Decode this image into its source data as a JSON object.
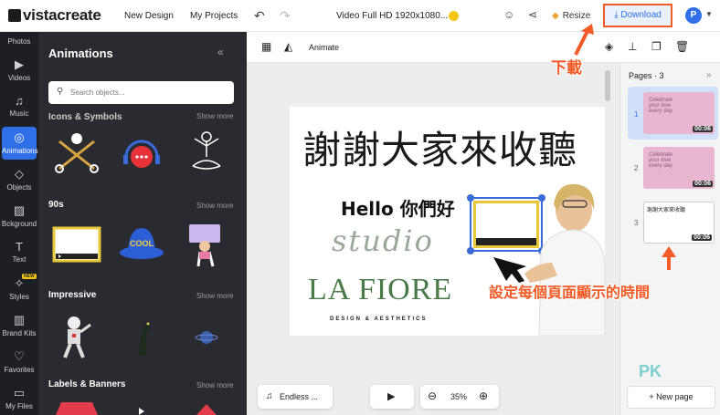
{
  "app": {
    "logo": "vistacreate",
    "nav": [
      "New Design",
      "My Projects"
    ],
    "doc_title": "Video Full HD 1920x1080...",
    "resize_label": "Resize",
    "download_label": "Download",
    "avatar_initial": "P"
  },
  "rail": [
    {
      "label": "Photos",
      "icon": "photos-icon"
    },
    {
      "label": "Videos",
      "icon": "videos-icon"
    },
    {
      "label": "Music",
      "icon": "music-icon"
    },
    {
      "label": "Animations",
      "icon": "animations-icon",
      "active": true
    },
    {
      "label": "Objects",
      "icon": "objects-icon"
    },
    {
      "label": "Bckground",
      "icon": "background-icon"
    },
    {
      "label": "Text",
      "icon": "text-icon"
    },
    {
      "label": "Styles",
      "icon": "styles-icon",
      "tag": "NEW"
    },
    {
      "label": "Brand Kits",
      "icon": "brand-kits-icon"
    },
    {
      "label": "Favorites",
      "icon": "favorites-icon"
    },
    {
      "label": "My Files",
      "icon": "my-files-icon"
    }
  ],
  "panel": {
    "title": "Animations",
    "search_placeholder": "Search objects...",
    "sections": [
      {
        "title": "Icons & Symbols",
        "show_more": "Show more"
      },
      {
        "title": "90s",
        "show_more": "Show more"
      },
      {
        "title": "Impressive",
        "show_more": "Show more"
      },
      {
        "title": "Labels & Banners",
        "show_more": "Show more"
      }
    ]
  },
  "toolbar": {
    "animate_label": "Animate"
  },
  "slide": {
    "headline": "謝謝大家來收聽",
    "hello_text": "Hello 你們好",
    "studio_text": "studio",
    "brand_name": "LA FIORE",
    "brand_tagline": "DESIGN & AESTHETICS"
  },
  "bottom": {
    "music_label": "Endless ...",
    "zoom": "35%"
  },
  "pages": {
    "header": "Pages · 3",
    "items": [
      {
        "number": "1",
        "duration": "00:06",
        "thumb_text": "Celebrate your love every day",
        "selected": true
      },
      {
        "number": "2",
        "duration": "00:06",
        "thumb_text": "Celebrate your love every day",
        "selected": false
      },
      {
        "number": "3",
        "duration": "00:06",
        "thumb_text": "謝謝大家來收聽",
        "selected": false
      }
    ],
    "new_page_label": "New page"
  },
  "annotations": {
    "download_note": "下載",
    "pages_note": "設定每個頁面顯示的時間",
    "watermark": "PK"
  },
  "colors": {
    "accent": "#2f6fe8",
    "annotation": "#f25a26",
    "dark_panel": "#2a2b31",
    "rail": "#1e1f24"
  }
}
